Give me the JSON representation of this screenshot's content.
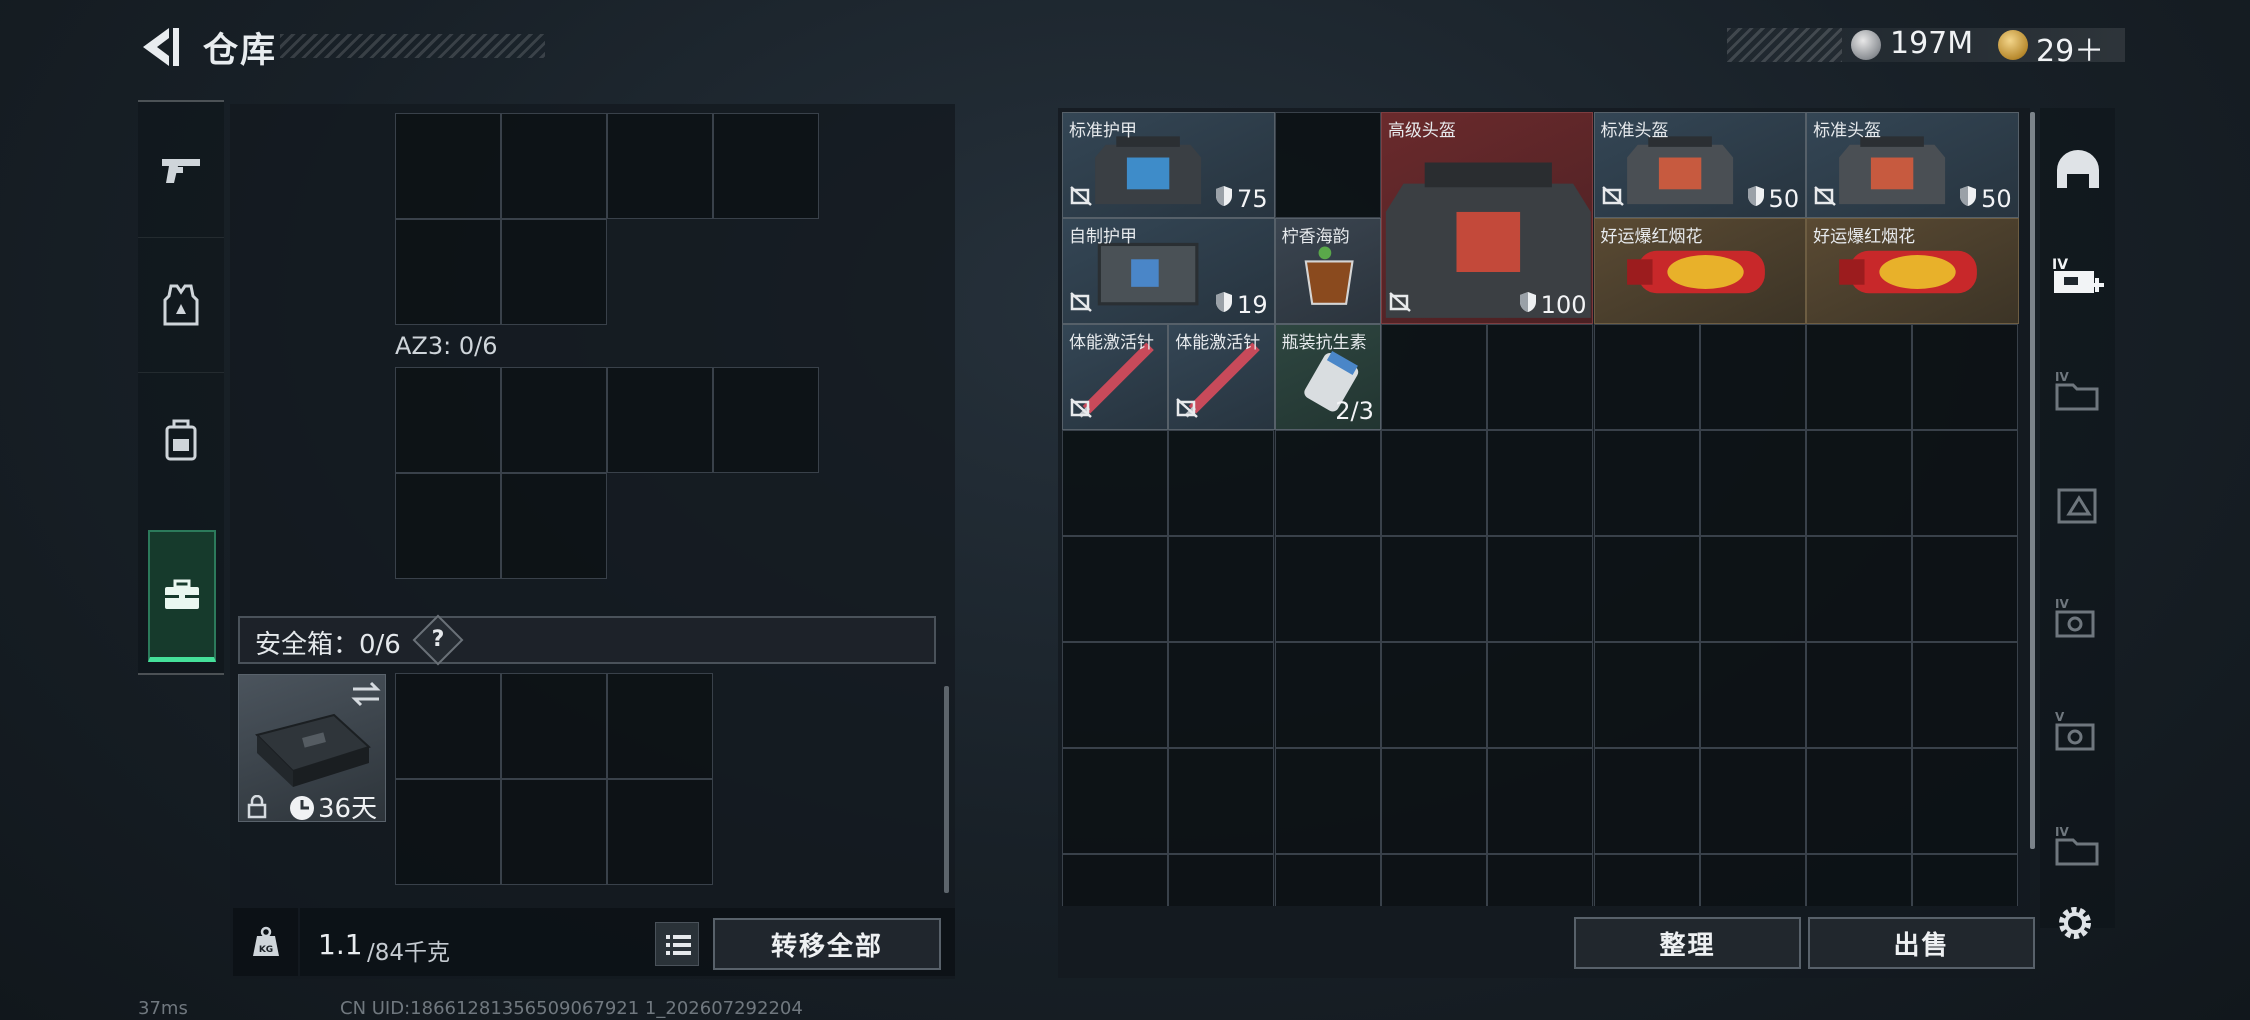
{
  "header": {
    "title": "仓库",
    "currency_silver": "197M",
    "currency_gold": "29＋"
  },
  "left_tabs": [
    {
      "icon": "pistol-icon"
    },
    {
      "icon": "armor-vest-icon"
    },
    {
      "icon": "backpack-icon"
    },
    {
      "icon": "briefcase-icon",
      "active": true
    }
  ],
  "loadout": {
    "az3_label": "AZ3: 0/6",
    "safe_box_label": "安全箱：0/6",
    "safe_box_help": "?",
    "case_days": "36天",
    "weight_value": "1.1",
    "weight_max": "/84千克",
    "transfer_all_label": "转移全部"
  },
  "stash": {
    "items": [
      {
        "name": "标准护甲",
        "stat": "75",
        "color": "blue"
      },
      {
        "name": "高级头盔",
        "stat": "100",
        "color": "red"
      },
      {
        "name": "标准头盔",
        "stat": "50",
        "color": "blue"
      },
      {
        "name": "标准头盔",
        "stat": "50",
        "color": "blue"
      },
      {
        "name": "自制护甲",
        "stat": "19",
        "color": "blue"
      },
      {
        "name": "柠香海韵",
        "stat": "",
        "color": "gray"
      },
      {
        "name": "好运爆红烟花",
        "stat": "",
        "color": "gold"
      },
      {
        "name": "好运爆红烟花",
        "stat": "",
        "color": "gold"
      },
      {
        "name": "体能激活针",
        "stat": "",
        "color": "blue"
      },
      {
        "name": "体能激活针",
        "stat": "",
        "color": "blue"
      },
      {
        "name": "瓶装抗生素",
        "stat": "2/3",
        "color": "green"
      }
    ],
    "sort_label": "整理",
    "sell_label": "出售"
  },
  "right_rail": [
    {
      "icon": "helmet-icon"
    },
    {
      "icon": "add-container-iv-icon"
    },
    {
      "icon": "container-iv-icon"
    },
    {
      "icon": "container-triangle-icon"
    },
    {
      "icon": "container-iv-camera-icon"
    },
    {
      "icon": "container-v-camera-icon"
    },
    {
      "icon": "container-iv-icon"
    }
  ],
  "status": {
    "ping": "37ms",
    "uid": "CN UID:18661281356509067921 1_202607292204"
  }
}
